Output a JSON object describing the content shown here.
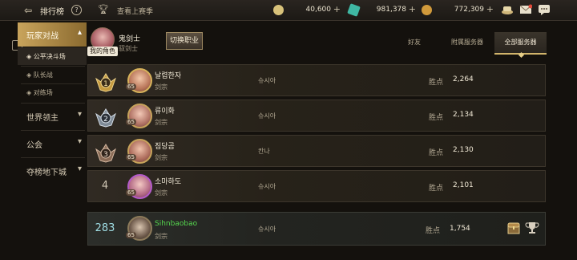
{
  "header": {
    "title": "排行榜",
    "help": "?",
    "season_label": "查看上赛季",
    "currencies": [
      {
        "name": "gold-coin",
        "value": "40,600",
        "color": "#d8c27a"
      },
      {
        "name": "crystal",
        "value": "981,378",
        "color": "#3fb7a3"
      },
      {
        "name": "medal-coin",
        "value": "772,309",
        "color": "#d19a3b"
      }
    ]
  },
  "sidebar": {
    "categories": [
      {
        "label": "玩家对战",
        "active": true
      },
      {
        "label": "世界领主"
      },
      {
        "label": "公会"
      },
      {
        "label": "夺榜地下城"
      }
    ],
    "sub_items": [
      {
        "label": "◈ 公平决斗场",
        "active": true
      },
      {
        "label": "◈ 队长战"
      },
      {
        "label": "◈ 对练场"
      }
    ]
  },
  "character": {
    "name": "鬼剑士",
    "job": "驭剑士",
    "my_role_tag": "我的角色",
    "switch_label": "切换职业"
  },
  "tabs": [
    {
      "label": "好友"
    },
    {
      "label": "附属服务器"
    },
    {
      "label": "全部服务器",
      "active": true
    }
  ],
  "rows": [
    {
      "rank": "1",
      "medal": "gold",
      "name": "날렵한자",
      "job": "剑宗",
      "level": "65",
      "server": "슈시아",
      "score_label": "胜点",
      "score": "2,264"
    },
    {
      "rank": "2",
      "medal": "silver",
      "name": "류이화",
      "job": "剑宗",
      "level": "65",
      "server": "슈시아",
      "score_label": "胜点",
      "score": "2,134"
    },
    {
      "rank": "3",
      "medal": "bronze",
      "name": "짐당곰",
      "job": "剑宗",
      "level": "65",
      "server": "칸나",
      "score_label": "胜点",
      "score": "2,130"
    },
    {
      "rank": "4",
      "medal": "",
      "name": "소마하도",
      "job": "剑宗",
      "level": "65",
      "server": "슈시아",
      "score_label": "胜点",
      "score": "2,101"
    }
  ],
  "my_row": {
    "rank": "283",
    "name": "Sihnbaobao",
    "job": "剑宗",
    "level": "65",
    "server": "슈시아",
    "score_label": "胜点",
    "score": "1,754"
  },
  "colors": {
    "accent": "#c9a45c",
    "my_name": "#55d64e",
    "my_rank": "#9fdde4"
  }
}
